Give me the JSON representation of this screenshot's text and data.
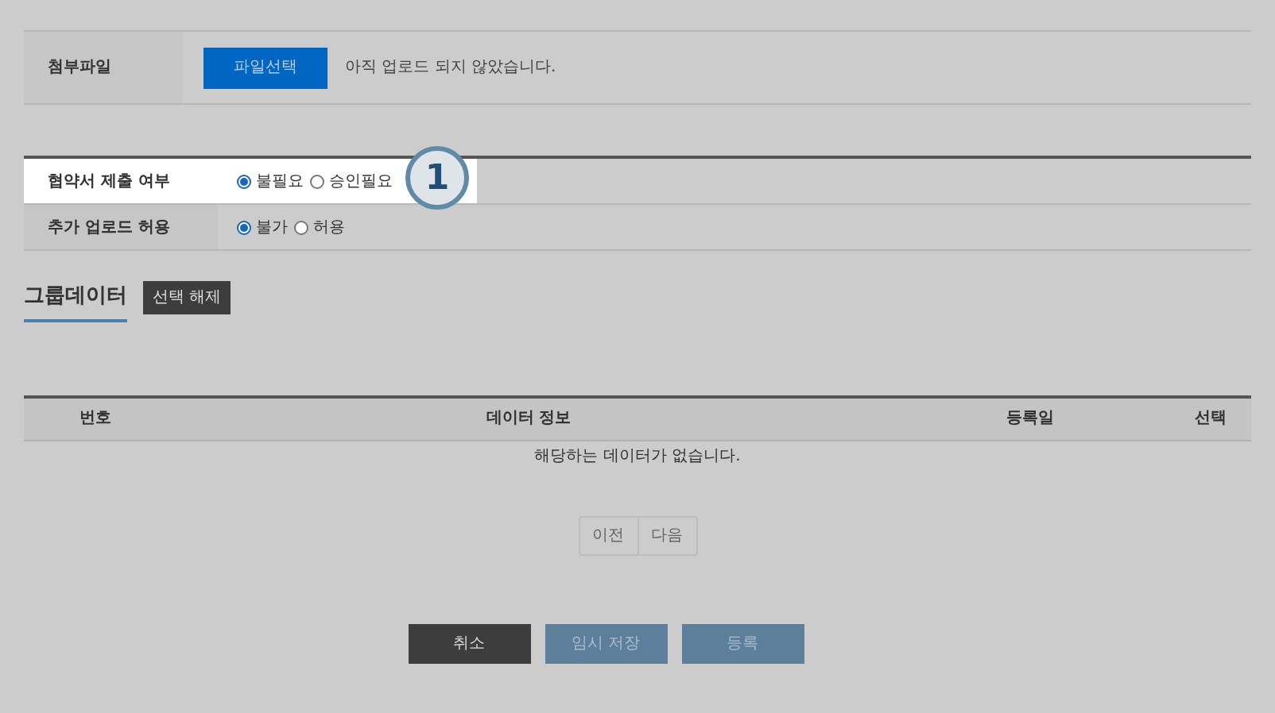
{
  "attachment": {
    "label": "첨부파일",
    "button": "파일선택",
    "status": "아직 업로드 되지 않았습니다."
  },
  "options": [
    {
      "label": "협약서 제출 여부",
      "highlighted": true,
      "choices": [
        {
          "label": "불필요",
          "selected": true
        },
        {
          "label": "승인필요",
          "selected": false
        }
      ]
    },
    {
      "label": "추가 업로드 허용",
      "highlighted": false,
      "choices": [
        {
          "label": "불가",
          "selected": true
        },
        {
          "label": "허용",
          "selected": false
        }
      ]
    }
  ],
  "callout": "1",
  "group": {
    "title": "그룹데이터",
    "clear_button": "선택 해제"
  },
  "table": {
    "columns": [
      "번호",
      "데이터 정보",
      "등록일",
      "선택"
    ],
    "empty_message": "해당하는 데이터가 없습니다."
  },
  "pager": [
    "이전",
    "다음"
  ],
  "actions": [
    {
      "label": "취소",
      "kind": "dark"
    },
    {
      "label": "임시 저장",
      "kind": "muted"
    },
    {
      "label": "등록",
      "kind": "muted"
    }
  ]
}
